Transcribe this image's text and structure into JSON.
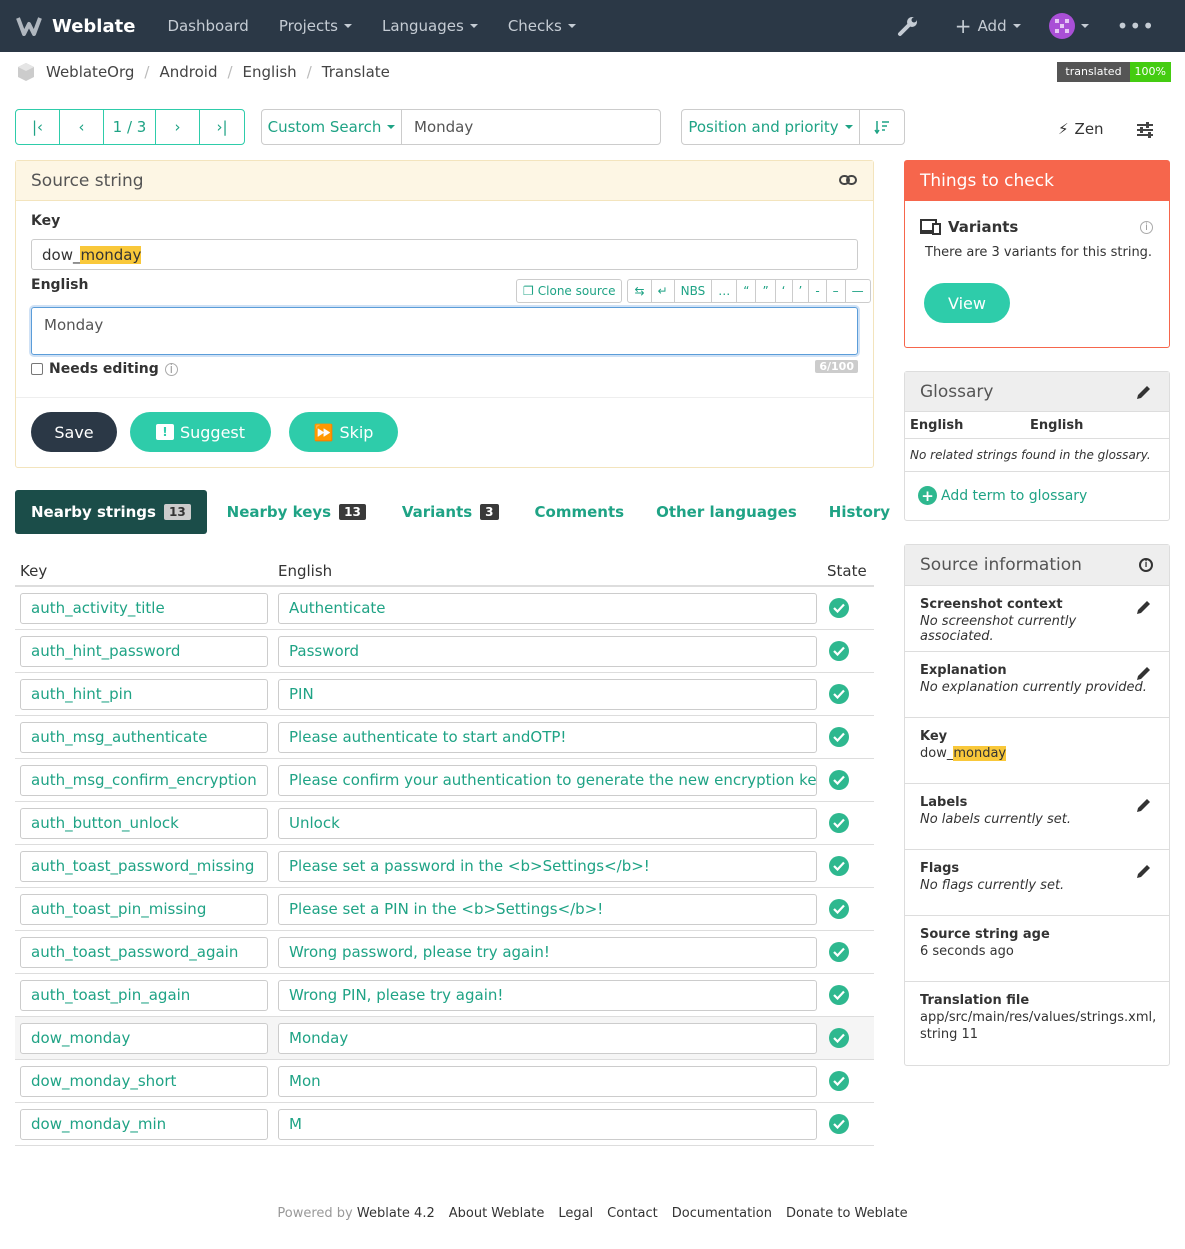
{
  "nav": {
    "brand": "Weblate",
    "items": [
      "Dashboard",
      "Projects",
      "Languages",
      "Checks"
    ],
    "add_label": "Add"
  },
  "breadcrumb": [
    "WeblateOrg",
    "Android",
    "English",
    "Translate"
  ],
  "status_badge": {
    "label": "translated",
    "value": "100%"
  },
  "pager": {
    "position": "1 / 3"
  },
  "search": {
    "mode": "Custom Search",
    "query": "Monday"
  },
  "sort": {
    "label": "Position and priority"
  },
  "zen_label": "Zen",
  "source": {
    "title": "Source string",
    "key_label": "Key",
    "key_prefix": "dow_",
    "key_highlight": "monday",
    "lang_label": "English",
    "clone_label": "Clone source",
    "special_chars": [
      "⇆",
      "↵",
      "NBS",
      "…",
      "“",
      "”",
      "‘",
      "’",
      "-",
      "–",
      "—"
    ],
    "text": "Monday",
    "needs_editing": "Needs editing",
    "counter": "6/100",
    "save": "Save",
    "suggest": "Suggest",
    "skip": "Skip"
  },
  "tabs": [
    {
      "label": "Nearby strings",
      "count": "13"
    },
    {
      "label": "Nearby keys",
      "count": "13"
    },
    {
      "label": "Variants",
      "count": "3"
    },
    {
      "label": "Comments",
      "count": ""
    },
    {
      "label": "Other languages",
      "count": ""
    },
    {
      "label": "History",
      "count": ""
    }
  ],
  "table": {
    "headers": [
      "Key",
      "English",
      "State"
    ],
    "rows": [
      {
        "key": "auth_activity_title",
        "text": "Authenticate"
      },
      {
        "key": "auth_hint_password",
        "text": "Password"
      },
      {
        "key": "auth_hint_pin",
        "text": "PIN"
      },
      {
        "key": "auth_msg_authenticate",
        "text": "Please authenticate to start andOTP!"
      },
      {
        "key": "auth_msg_confirm_encryption",
        "text": "Please confirm your authentication to generate the new encryption key!"
      },
      {
        "key": "auth_button_unlock",
        "text": "Unlock"
      },
      {
        "key": "auth_toast_password_missing",
        "text": "Please set a password in the <b>Settings</b>!"
      },
      {
        "key": "auth_toast_pin_missing",
        "text": "Please set a PIN in the <b>Settings</b>!"
      },
      {
        "key": "auth_toast_password_again",
        "text": "Wrong password, please try again!"
      },
      {
        "key": "auth_toast_pin_again",
        "text": "Wrong PIN, please try again!"
      },
      {
        "key": "dow_monday",
        "text": "Monday"
      },
      {
        "key": "dow_monday_short",
        "text": "Mon"
      },
      {
        "key": "dow_monday_min",
        "text": "M"
      }
    ]
  },
  "checks": {
    "title": "Things to check",
    "item_title": "Variants",
    "item_text": "There are 3 variants for this string.",
    "view_button": "View"
  },
  "glossary": {
    "title": "Glossary",
    "col1": "English",
    "col2": "English",
    "empty": "No related strings found in the glossary.",
    "add": "Add term to glossary"
  },
  "source_info": {
    "title": "Source information",
    "screenshot_label": "Screenshot context",
    "screenshot_value": "No screenshot currently associated.",
    "explanation_label": "Explanation",
    "explanation_value": "No explanation currently provided.",
    "key_label": "Key",
    "key_prefix": "dow_",
    "key_highlight": "monday",
    "labels_label": "Labels",
    "labels_value": "No labels currently set.",
    "flags_label": "Flags",
    "flags_value": "No flags currently set.",
    "age_label": "Source string age",
    "age_value": "6 seconds ago",
    "file_label": "Translation file",
    "file_value_1": "app/src/main/res/values/strings.xml,",
    "file_value_2": "string 11"
  },
  "footer": {
    "powered": "Powered by",
    "version": "Weblate 4.2",
    "links": [
      "About Weblate",
      "Legal",
      "Contact",
      "Documentation",
      "Donate to Weblate"
    ]
  },
  "colors": {
    "navbar": "#2b3846",
    "accent": "#2eccaa",
    "link": "#1fa385",
    "checks_header": "#f6664c",
    "save": "#2b3846"
  }
}
